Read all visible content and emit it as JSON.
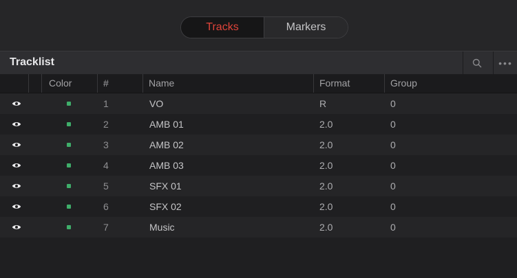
{
  "tabs": [
    {
      "label": "Tracks",
      "active": true
    },
    {
      "label": "Markers",
      "active": false
    }
  ],
  "tracklist": {
    "title": "Tracklist",
    "search_icon": "search-icon",
    "more_icon": "more-horizontal-icon"
  },
  "columns": {
    "color": "Color",
    "number": "#",
    "name": "Name",
    "format": "Format",
    "group": "Group"
  },
  "tracks": [
    {
      "number": "1",
      "name": "VO",
      "format": "R",
      "group": "0",
      "color": "#3fae6a"
    },
    {
      "number": "2",
      "name": "AMB 01",
      "format": "2.0",
      "group": "0",
      "color": "#3fae6a"
    },
    {
      "number": "3",
      "name": "AMB 02",
      "format": "2.0",
      "group": "0",
      "color": "#3fae6a"
    },
    {
      "number": "4",
      "name": "AMB 03",
      "format": "2.0",
      "group": "0",
      "color": "#3fae6a"
    },
    {
      "number": "5",
      "name": "SFX 01",
      "format": "2.0",
      "group": "0",
      "color": "#3fae6a"
    },
    {
      "number": "6",
      "name": "SFX 02",
      "format": "2.0",
      "group": "0",
      "color": "#3fae6a"
    },
    {
      "number": "7",
      "name": "Music",
      "format": "2.0",
      "group": "0",
      "color": "#3fae6a"
    }
  ],
  "colors": {
    "accent_active_tab": "#e0443a",
    "track_color": "#3fae6a"
  }
}
